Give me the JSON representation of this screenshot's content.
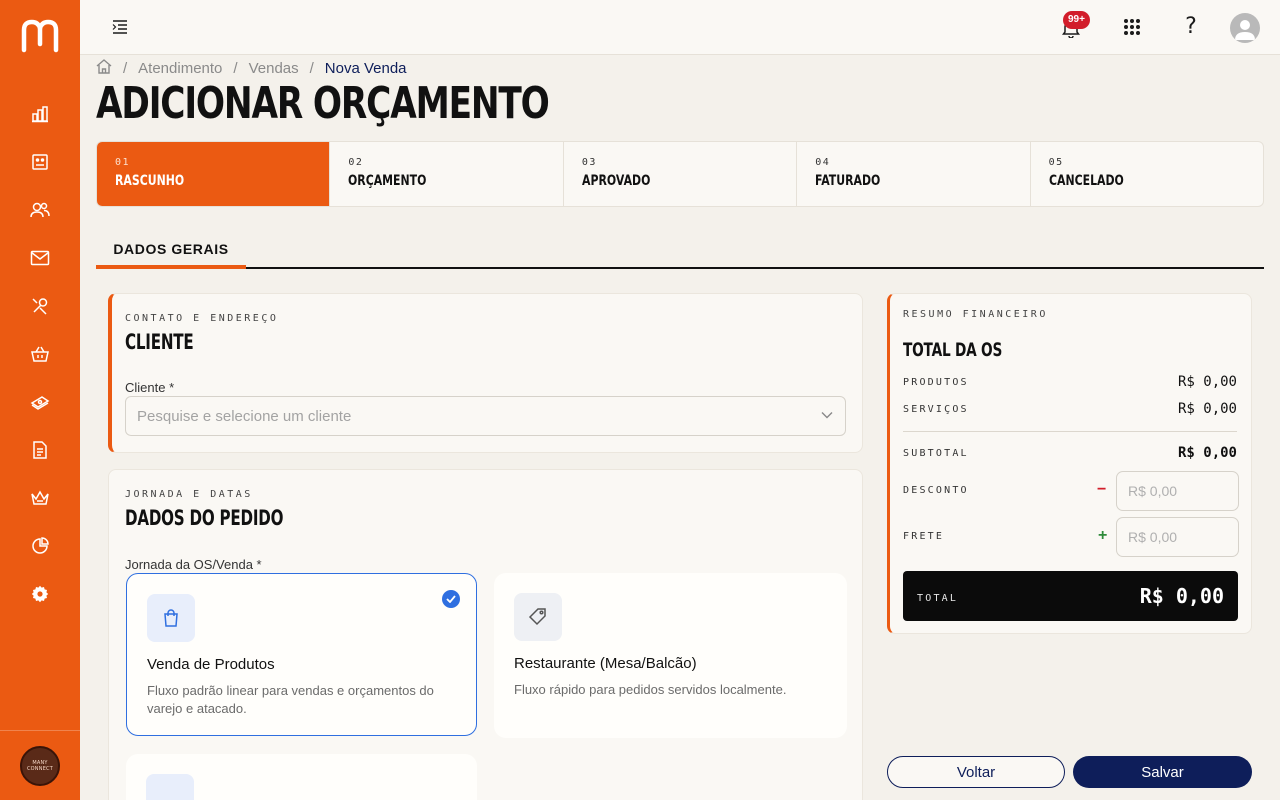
{
  "brand": {
    "accent": "#eb5a12",
    "navy": "#0e1e5a",
    "selection": "#2f6fe0"
  },
  "sidebar": {
    "items": [
      {
        "icon": "bar-chart-icon"
      },
      {
        "icon": "dashboard-icon"
      },
      {
        "icon": "users-icon"
      },
      {
        "icon": "mail-icon"
      },
      {
        "icon": "tools-icon"
      },
      {
        "icon": "basket-icon"
      },
      {
        "icon": "money-icon"
      },
      {
        "icon": "document-icon"
      },
      {
        "icon": "crown-icon"
      },
      {
        "icon": "pie-chart-icon"
      },
      {
        "icon": "gear-icon"
      }
    ],
    "company_logo_line1": "MANY",
    "company_logo_line2": "CONNECT"
  },
  "topbar": {
    "notifications_badge": "99+",
    "help_label": "?"
  },
  "breadcrumb": {
    "home_icon": "home-icon",
    "items": [
      "Atendimento",
      "Vendas"
    ],
    "current": "Nova Venda",
    "separator": "/"
  },
  "page": {
    "title": "ADICIONAR ORÇAMENTO"
  },
  "steps": [
    {
      "num": "01",
      "label": "RASCUNHO",
      "active": true
    },
    {
      "num": "02",
      "label": "ORÇAMENTO"
    },
    {
      "num": "03",
      "label": "APROVADO"
    },
    {
      "num": "04",
      "label": "FATURADO"
    },
    {
      "num": "05",
      "label": "CANCELADO"
    }
  ],
  "tabs": [
    {
      "label": "DADOS GERAIS",
      "active": true
    }
  ],
  "client_card": {
    "eyebrow": "CONTATO E ENDEREÇO",
    "title": "CLIENTE",
    "field_label": "Cliente *",
    "placeholder": "Pesquise e selecione um cliente"
  },
  "order_card": {
    "eyebrow": "JORNADA E DATAS",
    "title": "DADOS DO PEDIDO",
    "field_label": "Jornada da OS/Venda *",
    "options": [
      {
        "title": "Venda de Produtos",
        "desc_line1": "Fluxo padrão linear para vendas e orçamentos do",
        "desc_line2": "varejo e atacado.",
        "icon": "shopping-bag-icon",
        "selected": true
      },
      {
        "title": "Restaurante (Mesa/Balcão)",
        "desc_line1": "Fluxo rápido para pedidos servidos localmente.",
        "icon": "tag-icon"
      }
    ]
  },
  "summary": {
    "eyebrow": "RESUMO FINANCEIRO",
    "title": "TOTAL DA OS",
    "rows": [
      {
        "label": "PRODUTOS",
        "value": "R$ 0,00"
      },
      {
        "label": "SERVIÇOS",
        "value": "R$ 0,00"
      }
    ],
    "subtotal_label": "SUBTOTAL",
    "subtotal_value": "R$ 0,00",
    "discount_label": "DESCONTO",
    "discount_sign": "−",
    "discount_placeholder": "R$ 0,00",
    "freight_label": "FRETE",
    "freight_sign": "+",
    "freight_placeholder": "R$ 0,00",
    "total_label": "TOTAL",
    "total_value": "R$ 0,00"
  },
  "actions": {
    "back": "Voltar",
    "save": "Salvar"
  }
}
